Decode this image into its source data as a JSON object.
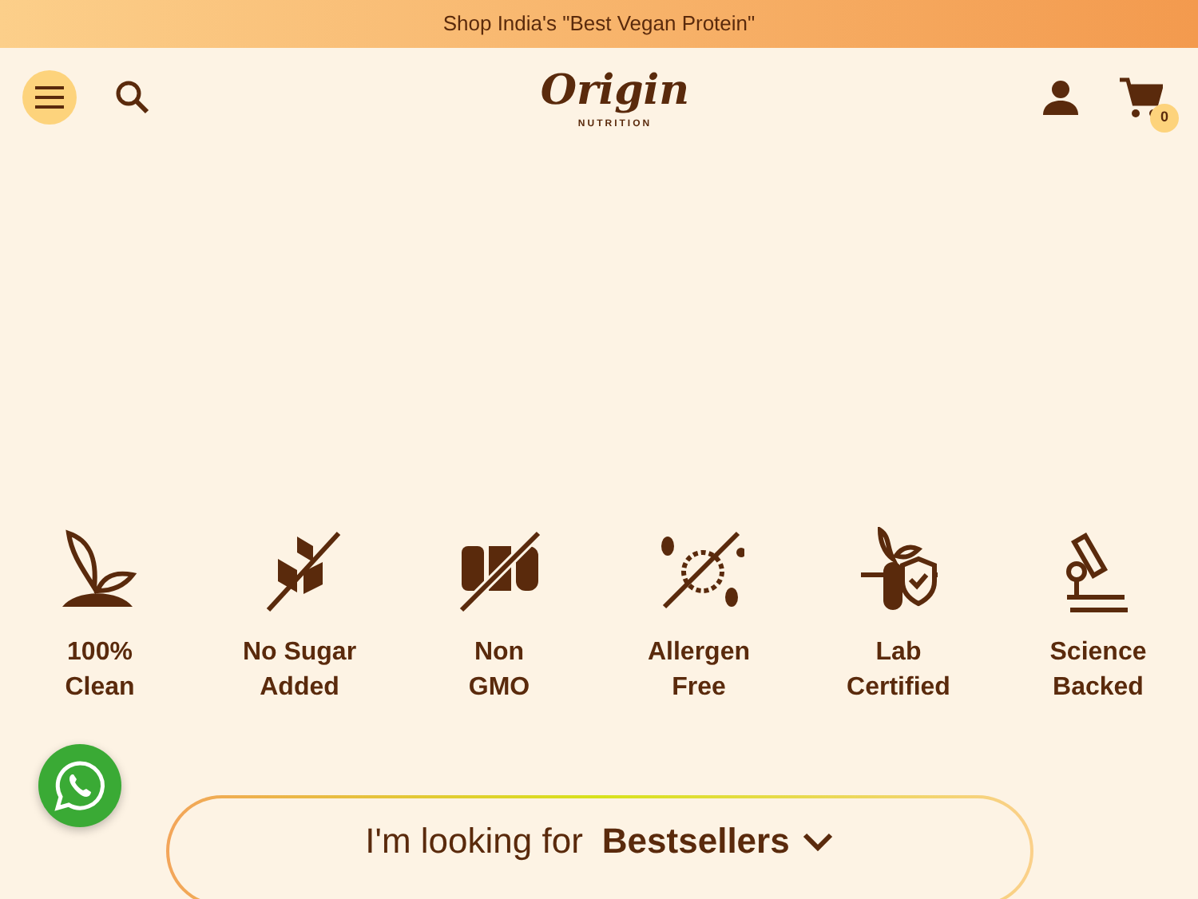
{
  "announcement": "Shop India's \"Best Vegan Protein\"",
  "header": {
    "logo": {
      "name": "Origin",
      "tagline": "NUTRITION"
    },
    "cart_count": "0"
  },
  "features": [
    {
      "kind": "plant",
      "lines": [
        "100%",
        "Clean"
      ]
    },
    {
      "kind": "sugar",
      "lines": [
        "No Sugar",
        "Added"
      ]
    },
    {
      "kind": "gmo",
      "lines": [
        "Non",
        "GMO"
      ]
    },
    {
      "kind": "allergen",
      "lines": [
        "Allergen",
        "Free"
      ]
    },
    {
      "kind": "lab",
      "lines": [
        "Lab",
        "Certified"
      ]
    },
    {
      "kind": "science",
      "lines": [
        "Science",
        "Backed"
      ]
    }
  ],
  "finder": {
    "prefix": "I'm looking for",
    "value": "Bestsellers"
  }
}
